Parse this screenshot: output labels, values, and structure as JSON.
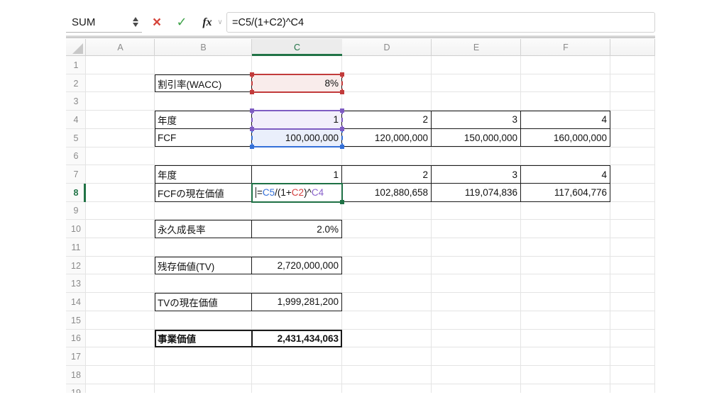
{
  "formula_bar": {
    "name_box_value": "SUM",
    "cancel_glyph": "×",
    "confirm_glyph": "✓",
    "fx_label": "fx",
    "chevron_glyph": "∨",
    "formula": "=C5/(1+C2)^C4"
  },
  "grid": {
    "column_headers": [
      "A",
      "B",
      "C",
      "D",
      "E",
      "F",
      ""
    ],
    "row_count": 19,
    "active_column": "C",
    "active_row": 8
  },
  "cells": [
    {
      "ref": "B2",
      "text": "割引率(WACC)",
      "align": "left"
    },
    {
      "ref": "C2",
      "text": "8%",
      "align": "right",
      "fill": "red"
    },
    {
      "ref": "B4",
      "text": "年度",
      "align": "left"
    },
    {
      "ref": "C4",
      "text": "1",
      "align": "right",
      "fill": "purple"
    },
    {
      "ref": "D4",
      "text": "2",
      "align": "right"
    },
    {
      "ref": "E4",
      "text": "3",
      "align": "right"
    },
    {
      "ref": "F4",
      "text": "4",
      "align": "right"
    },
    {
      "ref": "B5",
      "text": "FCF",
      "align": "left"
    },
    {
      "ref": "C5",
      "text": "100,000,000",
      "align": "right",
      "fill": "blue"
    },
    {
      "ref": "D5",
      "text": "120,000,000",
      "align": "right"
    },
    {
      "ref": "E5",
      "text": "150,000,000",
      "align": "right"
    },
    {
      "ref": "F5",
      "text": "160,000,000",
      "align": "right"
    },
    {
      "ref": "B7",
      "text": "年度",
      "align": "left"
    },
    {
      "ref": "C7",
      "text": "1",
      "align": "right"
    },
    {
      "ref": "D7",
      "text": "2",
      "align": "right"
    },
    {
      "ref": "E7",
      "text": "3",
      "align": "right"
    },
    {
      "ref": "F7",
      "text": "4",
      "align": "right"
    },
    {
      "ref": "B8",
      "text": "FCFの現在価値",
      "align": "left"
    },
    {
      "ref": "C8",
      "formula": true,
      "align": "left"
    },
    {
      "ref": "D8",
      "text": "102,880,658",
      "align": "right"
    },
    {
      "ref": "E8",
      "text": "119,074,836",
      "align": "right"
    },
    {
      "ref": "F8",
      "text": "117,604,776",
      "align": "right"
    },
    {
      "ref": "B10",
      "text": "永久成長率",
      "align": "left"
    },
    {
      "ref": "C10",
      "text": "2.0%",
      "align": "right"
    },
    {
      "ref": "B12",
      "text": "残存価値(TV)",
      "align": "left"
    },
    {
      "ref": "C12",
      "text": "2,720,000,000",
      "align": "right"
    },
    {
      "ref": "B14",
      "text": "TVの現在価値",
      "align": "left"
    },
    {
      "ref": "C14",
      "text": "1,999,281,200",
      "align": "right"
    },
    {
      "ref": "B16",
      "text": "事業価値",
      "align": "left",
      "bold": true
    },
    {
      "ref": "C16",
      "text": "2,431,434,063",
      "align": "right",
      "bold": true
    }
  ],
  "formula_cell": {
    "ref": "C8",
    "parts": [
      {
        "text": "=",
        "color": "black"
      },
      {
        "text": "C5",
        "color": "blue"
      },
      {
        "text": "/(1+",
        "color": "black"
      },
      {
        "text": "C2",
        "color": "red"
      },
      {
        "text": ")^",
        "color": "black"
      },
      {
        "text": "C4",
        "color": "purple"
      }
    ]
  },
  "ref_highlights": [
    {
      "cell": "C2",
      "color": "red"
    },
    {
      "cell": "C5",
      "color": "blue"
    },
    {
      "cell": "C4",
      "color": "purple"
    }
  ],
  "edit_cell": "C8",
  "colors": {
    "accent_green": "#217346",
    "check_green": "#3fa34a",
    "cancel_red": "#d6453c",
    "ref_red": "#c23b3b",
    "ref_red_fill": "#f9eceb",
    "ref_purple": "#7e5bc2",
    "ref_purple_fill": "#f2eefb",
    "ref_blue": "#3470d8",
    "ref_blue_fill": "#eaeffb",
    "edit_green": "#1e7145",
    "formula_blue": "#3470d8",
    "formula_red": "#d43f3f",
    "formula_purple": "#8a63cc",
    "formula_black": "#111111"
  }
}
